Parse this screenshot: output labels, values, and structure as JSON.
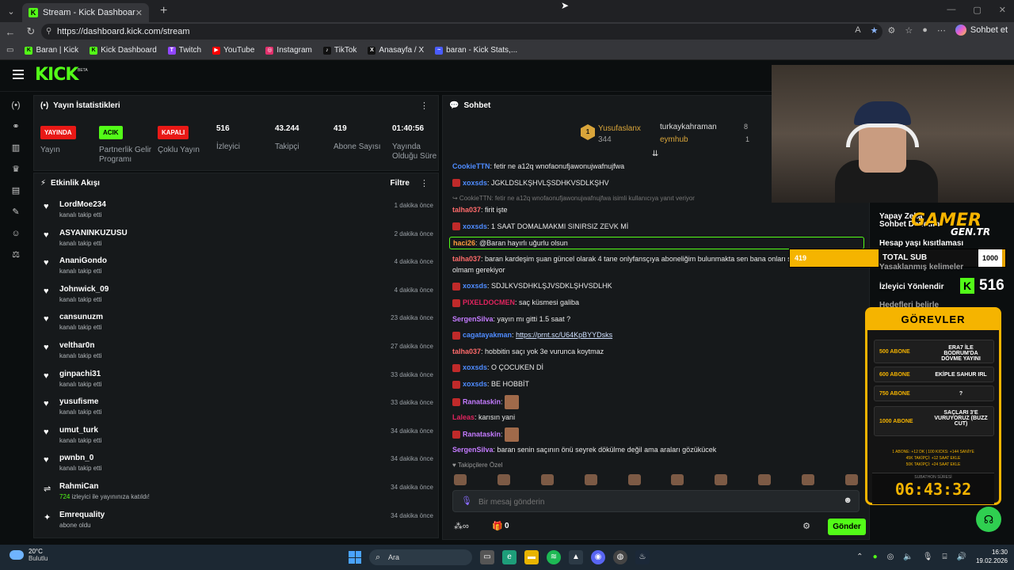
{
  "browser": {
    "tab_title": "Stream - Kick Dashboard",
    "url": "https://dashboard.kick.com/stream",
    "copilot_label": "Sohbet et",
    "bookmarks": [
      "Baran | Kick",
      "Kick Dashboard",
      "Twitch",
      "YouTube",
      "Instagram",
      "TikTok",
      "Anasayfa / X",
      "baran - Kick Stats,..."
    ]
  },
  "stats": {
    "title": "Yayın İstatistikleri",
    "items": [
      {
        "badge": "YAYINDA",
        "label": "Yayın"
      },
      {
        "badge": "ACIK",
        "label": "Partnerlik Gelir Programı"
      },
      {
        "badge": "KAPALI",
        "label": "Çoklu Yayın"
      },
      {
        "value": "516",
        "label": "İzleyici"
      },
      {
        "value": "43.244",
        "label": "Takipçi"
      },
      {
        "value": "419",
        "label": "Abone Sayısı"
      },
      {
        "value": "01:40:56",
        "label": "Yayında Olduğu Süre"
      }
    ]
  },
  "feed": {
    "title": "Etkinlik Akışı",
    "filter_label": "Filtre",
    "items": [
      {
        "name": "LordMoe234",
        "sub": "kanalı takip etti",
        "time": "1 dakika önce",
        "icon": "heart"
      },
      {
        "name": "ASYANINKUZUSU",
        "sub": "kanalı takip etti",
        "time": "2 dakika önce",
        "icon": "heart"
      },
      {
        "name": "AnaniGondo",
        "sub": "kanalı takip etti",
        "time": "4 dakika önce",
        "icon": "heart"
      },
      {
        "name": "Johnwick_09",
        "sub": "kanalı takip etti",
        "time": "4 dakika önce",
        "icon": "heart"
      },
      {
        "name": "cansunuzm",
        "sub": "kanalı takip etti",
        "time": "23 dakika önce",
        "icon": "heart"
      },
      {
        "name": "velthar0n",
        "sub": "kanalı takip etti",
        "time": "27 dakika önce",
        "icon": "heart"
      },
      {
        "name": "ginpachi31",
        "sub": "kanalı takip etti",
        "time": "33 dakika önce",
        "icon": "heart"
      },
      {
        "name": "yusufisme",
        "sub": "kanalı takip etti",
        "time": "33 dakika önce",
        "icon": "heart"
      },
      {
        "name": "umut_turk",
        "sub": "kanalı takip etti",
        "time": "34 dakika önce",
        "icon": "heart"
      },
      {
        "name": "pwnbn_0",
        "sub": "kanalı takip etti",
        "time": "34 dakika önce",
        "icon": "heart"
      },
      {
        "name": "RahmiCan",
        "sub_highlight": "724",
        "sub": "izleyici ile yayınınıza katıldı!",
        "time": "34 dakika önce",
        "icon": "raid"
      },
      {
        "name": "Emrequality",
        "sub": "abone oldu",
        "time": "34 dakika önce",
        "icon": "star"
      }
    ]
  },
  "chat": {
    "title": "Sohbet",
    "leaderboard": {
      "rank": "1",
      "top_name": "Yusufaslanx",
      "top_count": "344",
      "second_name": "turkaykahraman",
      "second_count": "8",
      "third_name": "eymhub",
      "third_count": "1"
    },
    "messages": [
      {
        "user": "CookieTTN",
        "color": "#4f8cff",
        "text": "fetir ne a12q wnofaonufjawonujwafnujfwa"
      },
      {
        "user": "xoxsds",
        "color": "#4f8cff",
        "text": "JGKLDSLKŞHVLŞSDHKVSDLKŞHV",
        "emote": true
      },
      {
        "reply": "↪ CookieTTN: fetir ne a12q wnofaonufjawonujwafnujfwa isimli kullanıcıya yanıt veriyor"
      },
      {
        "user": "talha037",
        "color": "#ff6b6b",
        "text": "firit işte"
      },
      {
        "user": "xoxsds",
        "color": "#4f8cff",
        "text": "1 SAAT DOMALMAKMI SINIRSIZ ZEVK Mİ",
        "emote": true
      },
      {
        "user": "haci26",
        "color": "#ff9c3d",
        "text": "@Baran hayırlı uğurlu olsun",
        "highlight": true
      },
      {
        "user": "talha037",
        "color": "#ff6b6b",
        "text": "baran kardeşim şuan güncel olarak 4 tane onlyfansçıya aboneliğim bulunmakta sen bana onları söyle neden abone olmam gerekiyor",
        "wrap": true
      },
      {
        "user": "xoxsds",
        "color": "#4f8cff",
        "text": "SDJLKVSDHKLŞJVSDKLŞHVSDLHK",
        "emote": true
      },
      {
        "user": "PIXELDOCMEN",
        "color": "#e0245e",
        "text": "saç küsmesi galiba",
        "emote": true
      },
      {
        "user": "SergenSilva",
        "color": "#c47bff",
        "text": "yayın mı gitti 1.5 saat ?"
      },
      {
        "user": "cagatayakman",
        "color": "#4f8cff",
        "text": "https://prnt.sc/U64KpBYYDsks",
        "emote": true,
        "link": true
      },
      {
        "user": "talha037",
        "color": "#ff6b6b",
        "text": "hobbitin saçı yok 3e vurunca koytmaz"
      },
      {
        "user": "xoxsds",
        "color": "#4f8cff",
        "text": "O ÇOCUKEN Dİ",
        "emote": true
      },
      {
        "user": "xoxsds",
        "color": "#4f8cff",
        "text": "BE HOBBİT",
        "emote": true
      },
      {
        "user": "Ranataskin",
        "color": "#c47bff",
        "text": "",
        "emote": true,
        "image": true
      },
      {
        "user": "Laleas",
        "color": "#e0245e",
        "text": "karısın yani"
      },
      {
        "user": "Ranataskin",
        "color": "#c47bff",
        "text": "",
        "emote": true,
        "image": true
      },
      {
        "user": "SergenSilva",
        "color": "#c47bff",
        "text": "baran senin saçının önü seyrek dökülme değil ama araları gözükücek"
      }
    ],
    "followers_only": "♥ Takipçilere Özel",
    "input_placeholder": "Bir mesaj gönderin",
    "gift_count": "0",
    "send_label": "Gönder"
  },
  "overlay": {
    "ai_label": "Yapay Zeka",
    "ai_label2": "Sohbet Denetimi",
    "age_label": "Hesap yaşı kısıtlaması",
    "banned_label": "Yasaklanmış kelimeler",
    "redirect_label": "İzleyici Yönlendir",
    "goals_label": "Hedefleri belirle",
    "brand1": "GAMER",
    "brand2": "GEN.TR",
    "sub_value": "419",
    "sub_label": "TOTAL SUB",
    "sub_goal": "1000",
    "sub_progress": 0.419,
    "viewer_count": "516",
    "tasks_title": "GÖREVLER",
    "tasks": [
      {
        "left": "500 ABONE",
        "right": "ERA7 İLE BODRUM'DA DÖVME YAYINI"
      },
      {
        "left": "600 ABONE",
        "right": "EKİPLE SAHUR IRL"
      },
      {
        "left": "750 ABONE",
        "right": "?"
      },
      {
        "left": "1000 ABONE",
        "right": "SAÇLARI 3'E VURUYORUZ (BUZZ CUT)"
      }
    ],
    "rule1": "1 ABONE: +12 DK | 100 KICKS: +144 SANİYE",
    "rule2": "45K TAKİPÇİ: +12 SAAT EKLE",
    "rule3": "50K TAKİPÇİ: +24 SAAT EKLE",
    "subathon_label": "SUBATHON SÜRESİ",
    "subathon_time": "06:43:32"
  },
  "taskbar": {
    "temp": "20°C",
    "weather": "Bulutlu",
    "search": "Ara",
    "time": "16:30",
    "date": "19.02.2026"
  }
}
